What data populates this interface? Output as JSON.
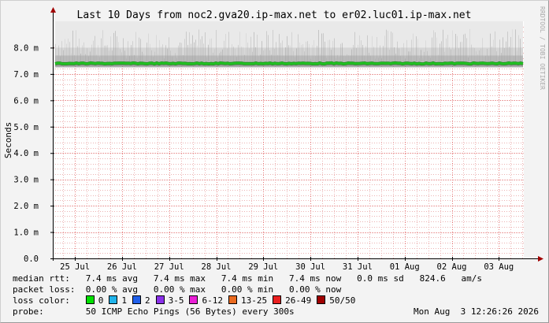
{
  "chart_data": {
    "type": "area",
    "title": "Last 10 Days from noc2.gva20.ip-max.net to er02.luc01.ip-max.net",
    "ylabel": "Seconds",
    "xlabel": "",
    "ylim": [
      0,
      9.0
    ],
    "y_ticks": [
      "0.0",
      "1.0 m",
      "2.0 m",
      "3.0 m",
      "4.0 m",
      "5.0 m",
      "6.0 m",
      "7.0 m",
      "8.0 m"
    ],
    "y_tick_values": [
      0,
      1,
      2,
      3,
      4,
      5,
      6,
      7,
      8
    ],
    "x_ticks": [
      "25 Jul",
      "26 Jul",
      "27 Jul",
      "28 Jul",
      "29 Jul",
      "30 Jul",
      "31 Jul",
      "01 Aug",
      "02 Aug",
      "03 Aug"
    ],
    "x_tick_days": [
      1,
      2,
      3,
      4,
      5,
      6,
      7,
      8,
      9,
      10
    ],
    "x_range_days": [
      0.53,
      10.53
    ],
    "median_ms": 7.4,
    "smoke_band_ms": [
      7.3,
      9.0
    ],
    "grid": true,
    "colors": {
      "median": "#22c322",
      "median_border": "#1a8f1a",
      "smoke": "#a0a0a0",
      "grid": "#e8a0a0",
      "axis": "#000000",
      "arrow": "#a00000"
    }
  },
  "watermark": "RRDTOOL / TOBI OETIKER",
  "legend": {
    "median_label": "median rtt:",
    "median_values": "7.4 ms avg   7.4 ms max   7.4 ms min   7.4 ms now   0.0 ms sd   824.6   am/s",
    "loss_label": "packet loss:",
    "loss_values": "0.00 % avg   0.00 % max   0.00 % min   0.00 % now",
    "color_label": "loss color:",
    "loss_colors": [
      {
        "label": "0",
        "color": "#00e000"
      },
      {
        "label": "1",
        "color": "#1fb3ea"
      },
      {
        "label": "2",
        "color": "#1f5fea"
      },
      {
        "label": "3-5",
        "color": "#8a30ea"
      },
      {
        "label": "6-12",
        "color": "#ea1fd6"
      },
      {
        "label": "13-25",
        "color": "#ea6a1f"
      },
      {
        "label": "26-49",
        "color": "#ea1f1f"
      },
      {
        "label": "50/50",
        "color": "#a00000"
      }
    ],
    "probe_label": "probe:",
    "probe_value": "50 ICMP Echo Pings (56 Bytes) every 300s",
    "timestamp": "Mon Aug  3 12:26:26 2026"
  }
}
